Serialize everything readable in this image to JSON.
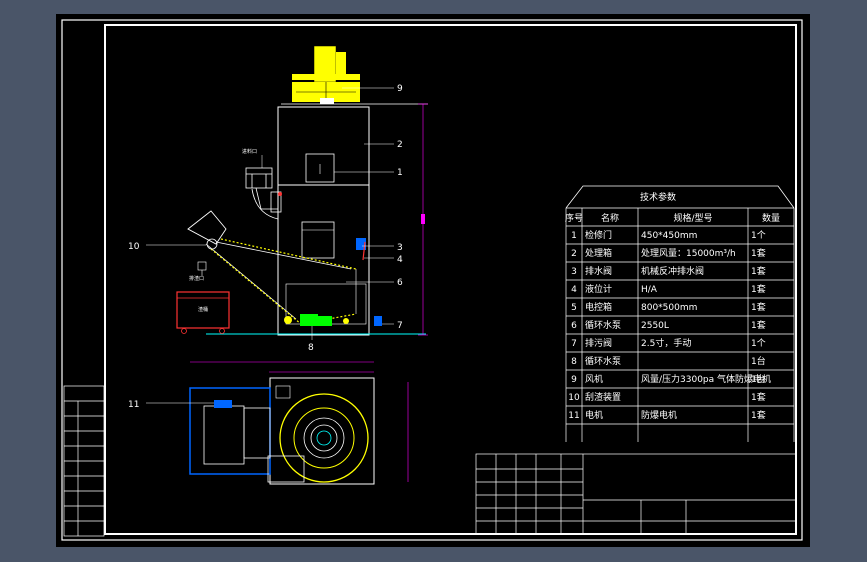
{
  "colors": {
    "background": "#000000",
    "frame": "#ffffff",
    "machine": "#ffffff",
    "motor": "#ffff00",
    "belt": "#ffff00",
    "accent_green": "#00ff00",
    "dimension": "#ff00ff",
    "leader": "#ffffff",
    "ground": "#00ffff",
    "bin": "#ff3333",
    "pump": "#0066ff"
  },
  "callouts": {
    "n1": "1",
    "n2": "2",
    "n3": "3",
    "n4": "4",
    "n5": "6",
    "n6": "7",
    "n7": "8",
    "n8": "9",
    "n9": "10",
    "n10": "11"
  },
  "annotations": {
    "feed_inlet": "进料口",
    "discharge": "排渣口",
    "bin": "渣桶"
  },
  "tech_table": {
    "title": "技术参数",
    "headers": [
      "序号",
      "名称",
      "规格/型号",
      "数量"
    ],
    "rows": [
      [
        "1",
        "检修门",
        "450*450mm",
        "1个"
      ],
      [
        "2",
        "处理箱",
        "处理风量：15000m³/h",
        "1套"
      ],
      [
        "3",
        "排水阀",
        "机械反冲排水阀",
        "1套"
      ],
      [
        "4",
        "液位计",
        "H/A",
        "1套"
      ],
      [
        "5",
        "电控箱",
        "800*500mm",
        "1套"
      ],
      [
        "6",
        "循环水泵",
        "2550L",
        "1套"
      ],
      [
        "7",
        "排污阀",
        "2.5寸，手动",
        "1个"
      ],
      [
        "8",
        "循环水泵",
        "",
        "1台"
      ],
      [
        "9",
        "风机",
        "风量/压力3300pa 气体防爆电机",
        "1台"
      ],
      [
        "10",
        "刮渣装置",
        "",
        "1套"
      ],
      [
        "11",
        "电机",
        "防爆电机",
        "1套"
      ]
    ]
  }
}
